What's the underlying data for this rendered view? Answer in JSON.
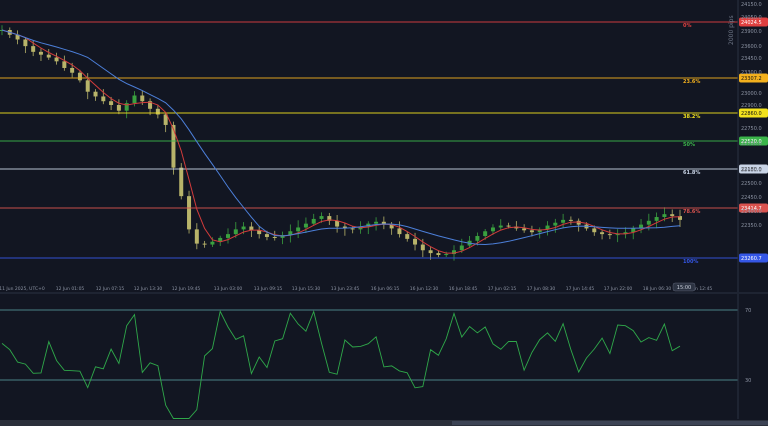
{
  "chart_data": [
    {
      "type": "candlestick",
      "x_ticks": [
        "11 Jun 2025, UTC+0",
        "12 Jun 01:05",
        "12 Jun 07:15",
        "12 Jun 13:30",
        "12 Jun 19:45",
        "13 Jun 03:00",
        "13 Jun 09:15",
        "13 Jun 15:30",
        "13 Jun 23:45",
        "16 Jun 06:15",
        "16 Jun 12:30",
        "16 Jun 18:45",
        "17 Jun 02:15",
        "17 Jun 08:30",
        "17 Jun 14:45",
        "17 Jun 22:00",
        "18 Jun 06:30",
        "18 Jun 12:45"
      ],
      "crosshair_time": "15:00",
      "y_ticks": [
        {
          "value": 24150,
          "label": "24150.0"
        },
        {
          "value": 24050,
          "label": "24050.0"
        },
        {
          "value": 23900,
          "label": "23900.0"
        },
        {
          "value": 23600,
          "label": "23600.0"
        },
        {
          "value": 23450,
          "label": "23450.0"
        },
        {
          "value": 23300,
          "label": "23300.0"
        },
        {
          "value": 23000,
          "label": "23000.0"
        },
        {
          "value": 22900,
          "label": "22900.0"
        },
        {
          "value": 22750,
          "label": "22750.0"
        },
        {
          "value": 22700,
          "label": "22700.0"
        },
        {
          "value": 22600,
          "label": "22600.0"
        },
        {
          "value": 22500,
          "label": "22500.0"
        },
        {
          "value": 22450,
          "label": "22450.0"
        },
        {
          "value": 22400,
          "label": "22400.0"
        },
        {
          "value": 22350,
          "label": "22350.0"
        }
      ],
      "scale_note": "2000 pips",
      "fib_levels": [
        {
          "label": "0%",
          "price_tag": "24024.5",
          "color": "#e04040"
        },
        {
          "label": "23.6%",
          "price_tag": "23307.2",
          "color": "#f2b01e"
        },
        {
          "label": "38.2%",
          "price_tag": "22860.0",
          "color": "#f2e21e"
        },
        {
          "label": "50%",
          "price_tag": "22520.0",
          "color": "#3bb54a"
        },
        {
          "label": "61.8%",
          "price_tag": "22180.0",
          "color": "#c9d4e6"
        },
        {
          "label": "78.6%",
          "price_tag": "23414.7",
          "color": "#d9534f"
        },
        {
          "label": "100%",
          "price_tag": "23260.7",
          "color": "#3557e6"
        }
      ],
      "series": [
        {
          "name": "price",
          "values": [
            24050,
            24000,
            23950,
            23880,
            23820,
            23790,
            23760,
            23720,
            23650,
            23600,
            23520,
            23400,
            23350,
            23300,
            23260,
            23200,
            23280,
            23360,
            23300,
            23220,
            23160,
            23050,
            22600,
            22300,
            21950,
            21800,
            21790,
            21820,
            21860,
            21900,
            21950,
            21980,
            21940,
            21900,
            21870,
            21860,
            21890,
            21930,
            21970,
            22010,
            22060,
            22090,
            22040,
            21980,
            21960,
            21950,
            21980,
            22010,
            22030,
            22000,
            21960,
            21900,
            21850,
            21790,
            21730,
            21700,
            21680,
            21690,
            21730,
            21780,
            21830,
            21880,
            21930,
            21970,
            21990,
            21980,
            21960,
            21940,
            21920,
            21950,
            21990,
            22020,
            22050,
            22040,
            22000,
            21960,
            21920,
            21900,
            21890,
            21900,
            21920,
            21960,
            22000,
            22040,
            22080,
            22110,
            22090,
            22050
          ]
        },
        {
          "name": "ma_fast",
          "color": "#d23b3b"
        },
        {
          "name": "ma_slow",
          "color": "#4c7fd9"
        }
      ]
    },
    {
      "type": "line",
      "y_ticks": [
        {
          "value": 70,
          "label": "70"
        },
        {
          "value": 30,
          "label": "30"
        }
      ],
      "levels": [
        70,
        30
      ],
      "color": "#2fa84a"
    }
  ]
}
